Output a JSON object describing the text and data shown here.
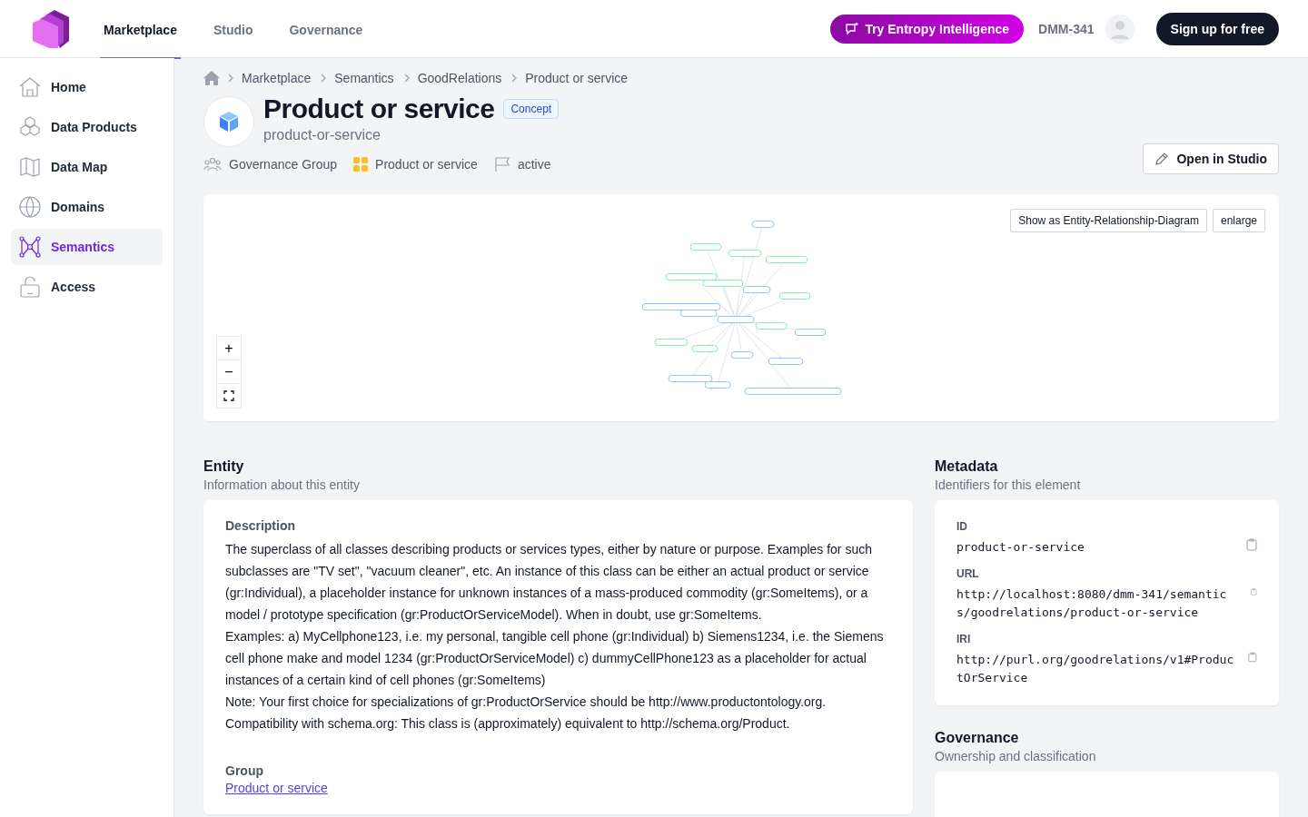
{
  "header": {
    "tabs": [
      {
        "label": "Marketplace",
        "selected": true
      },
      {
        "label": "Studio",
        "selected": false
      },
      {
        "label": "Governance",
        "selected": false
      }
    ],
    "ai_button": "Try Entropy Intelligence",
    "workspace": "DMM-341",
    "signup_button": "Sign up for free"
  },
  "sidebar": {
    "items": [
      {
        "label": "Home",
        "selected": false
      },
      {
        "label": "Data Products",
        "selected": false
      },
      {
        "label": "Data Map",
        "selected": false
      },
      {
        "label": "Domains",
        "selected": false
      },
      {
        "label": "Semantics",
        "selected": true
      },
      {
        "label": "Access",
        "selected": false
      }
    ]
  },
  "breadcrumb": [
    "Marketplace",
    "Semantics",
    "GoodRelations",
    "Product or service"
  ],
  "entity": {
    "title": "Product or service",
    "badge": "Concept",
    "slug": "product-or-service",
    "owner": "Governance Group",
    "group": "Product or service",
    "status": "active",
    "open_button": "Open in Studio"
  },
  "diagram": {
    "er_button": "Show as Entity-Relationship-Diagram",
    "enlarge_button": "enlarge",
    "zoom_in": "+",
    "zoom_out": "−"
  },
  "entity_section": {
    "title": "Entity",
    "subtitle": "Information about this entity",
    "description_label": "Description",
    "description": [
      "The superclass of all classes describing products or services types, either by nature or purpose. Examples for such subclasses are \"TV set\", \"vacuum cleaner\", etc. An instance of this class can be either an actual product or service (gr:Individual), a placeholder instance for unknown instances of a mass-produced commodity (gr:SomeItems), or a model / prototype specification (gr:ProductOrServiceModel). When in doubt, use gr:SomeItems.",
      "Examples: a) MyCellphone123, i.e. my personal, tangible cell phone (gr:Individual) b) Siemens1234, i.e. the Siemens cell phone make and model 1234 (gr:ProductOrServiceModel) c) dummyCellPhone123 as a placeholder for actual instances of a certain kind of cell phones (gr:SomeItems)",
      "Note: Your first choice for specializations of gr:ProductOrService should be http://www.productontology.org. Compatibility with schema.org: This class is (approximately) equivalent to http://schema.org/Product."
    ],
    "group_label": "Group",
    "group_link": "Product or service"
  },
  "metadata": {
    "title": "Metadata",
    "subtitle": "Identifiers for this element",
    "fields": [
      {
        "label": "ID",
        "value": "product-or-service"
      },
      {
        "label": "URL",
        "value": "http://localhost:8080/dmm-341/semantics/goodrelations/product-or-service"
      },
      {
        "label": "IRI",
        "value": "http://purl.org/goodrelations/v1#ProductOrService"
      }
    ]
  },
  "governance": {
    "title": "Governance",
    "subtitle": "Ownership and classification"
  }
}
